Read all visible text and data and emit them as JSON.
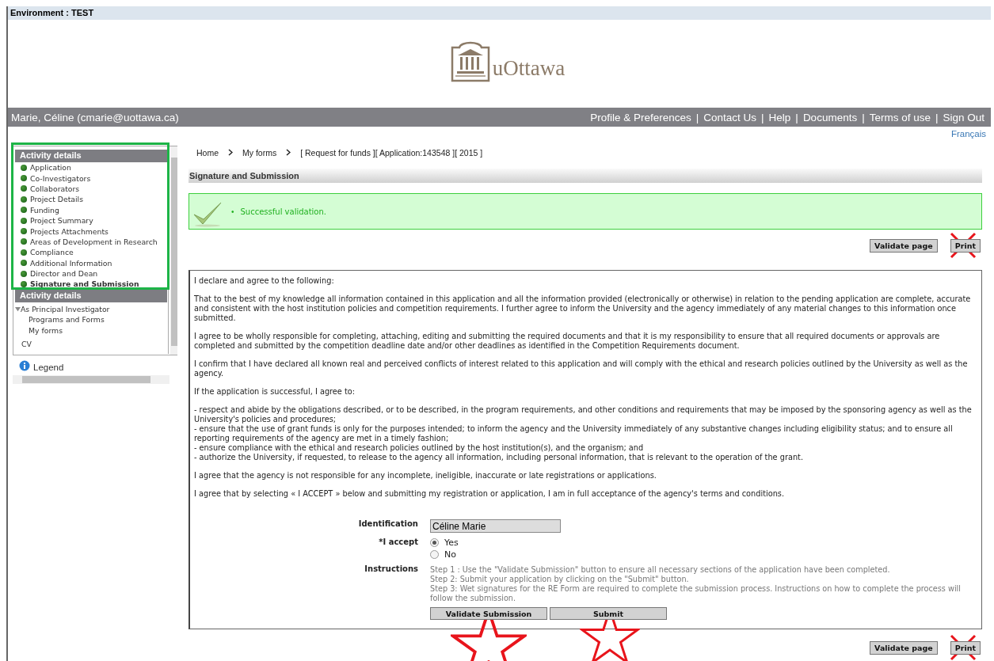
{
  "environment": "Environment : TEST",
  "logo": {
    "text": "uOttawa"
  },
  "user_bar": {
    "user": "Marie, Céline (cmarie@uottawa.ca)",
    "separator": "|",
    "links": [
      "Profile & Preferences",
      "Contact Us",
      "Help",
      "Documents",
      "Terms of use",
      "Sign Out"
    ]
  },
  "language_link": "Français",
  "sidebar": {
    "highlighted": true,
    "title": "Activity details",
    "items": [
      {
        "label": "Application",
        "selected": false
      },
      {
        "label": "Co-Investigators",
        "selected": false
      },
      {
        "label": "Collaborators",
        "selected": false
      },
      {
        "label": "Project Details",
        "selected": false
      },
      {
        "label": "Funding",
        "selected": false
      },
      {
        "label": "Project Summary",
        "selected": false
      },
      {
        "label": "Projects Attachments",
        "selected": false
      },
      {
        "label": "Areas of Development in Research",
        "selected": false
      },
      {
        "label": "Compliance",
        "selected": false
      },
      {
        "label": "Additional Information",
        "selected": false
      },
      {
        "label": "Director and Dean",
        "selected": false
      },
      {
        "label": "Signature and Submission",
        "selected": true
      }
    ],
    "second_title": "Activity details",
    "tree": [
      {
        "label": "As Principal Investigator",
        "expanded": true,
        "children": [
          {
            "label": "Programs and Forms"
          },
          {
            "label": "My forms"
          }
        ]
      },
      {
        "label": "CV"
      }
    ],
    "legend": "Legend"
  },
  "breadcrumb": [
    "Home",
    "My forms",
    "[ Request for funds ][ Application:143548 ][ 2015 ]"
  ],
  "section_title": "Signature and Submission",
  "message": {
    "bullet": "•",
    "text": "Successful validation."
  },
  "top_buttons": [
    {
      "label": "Validate page",
      "crossed_out": false
    },
    {
      "label": "Print",
      "crossed_out": true
    }
  ],
  "declaration": [
    "I declare and agree to the following:",
    "That to the best of my knowledge all information contained in this application and all the information provided (electronically or otherwise) in relation to the pending application are complete, accurate and consistent with the host institution policies and competition requirements. I further agree to inform the University and the agency immediately of any material changes to this information once submitted.",
    "I agree to be wholly responsible for completing, attaching, editing and submitting the required documents and that it is my responsibility to ensure that all required documents or approvals are completed and submitted by the competition deadline date and/or other deadlines as identified in the Competition Requirements document.",
    "I confirm that I have declared all known real and perceived conflicts of interest related to this application and will comply with the ethical and research policies outlined by the University as well as the agency.",
    "If the application is successful, I agree to:",
    "- respect and abide by the obligations described, or to be described, in the program requirements, and other conditions and requirements that may be imposed by the sponsoring agency as well as the University's policies and procedures;\n- ensure that the use of grant funds is only for the purposes intended; to inform the agency and the University immediately of any substantive changes including eligibility status; and to ensure all reporting requirements of the agency are met in a timely fashion;\n- ensure compliance with the ethical and research policies outlined by the host institution(s), and the organism; and\n- authorize the University, if requested, to release to the agency all information, including personal information, that is relevant to the operation of the grant.",
    "I agree that the agency is not responsible for any incomplete, ineligible, inaccurate or late registrations or applications.",
    "I agree that by selecting « I ACCEPT » below and submitting my registration or application, I am in full acceptance of the agency's terms and conditions."
  ],
  "form": {
    "identification_label": "Identification",
    "identification_value": "Céline Marie",
    "accept_label": "*I accept",
    "options": [
      {
        "label": "Yes",
        "selected": true
      },
      {
        "label": "No",
        "selected": false
      }
    ],
    "instructions_label": "Instructions",
    "instructions": [
      "Step 1 : Use the \"Validate Submission\" button to ensure all necessary sections of the application have been completed.",
      "Step 2: Submit your application by clicking on the \"Submit\" button.",
      "Step 3: Wet signatures for the RE Form are required to complete the submission process. Instructions on how to complete the process will follow the submission."
    ],
    "buttons": [
      {
        "label": "Validate Submission",
        "starred": true
      },
      {
        "label": "Submit",
        "starred": true
      }
    ]
  },
  "bottom_buttons": [
    {
      "label": "Validate page",
      "crossed_out": false
    },
    {
      "label": "Print",
      "crossed_out": true
    }
  ]
}
